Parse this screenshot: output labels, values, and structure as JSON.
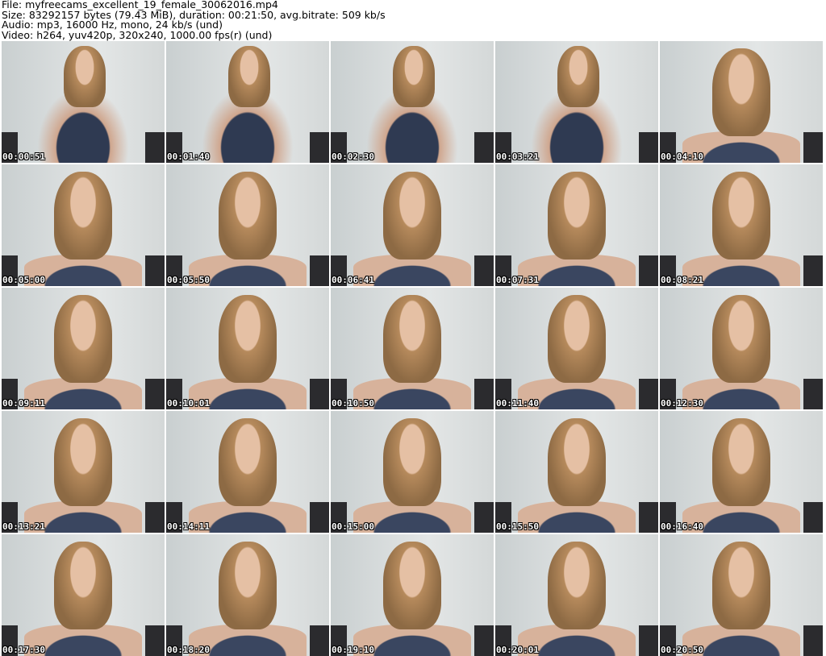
{
  "header": {
    "file": "File: myfreecams_excellent_19_female_30062016.mp4",
    "size": "Size: 83292157 bytes (79.43 MiB), duration: 00:21:50, avg.bitrate: 509 kb/s",
    "audio": "Audio: mp3, 16000 Hz, mono, 24 kb/s (und)",
    "video": "Video: h264, yuv420p, 320x240, 1000.00 fps(r) (und)"
  },
  "thumbnails": [
    "00:00:51",
    "00:01:40",
    "00:02:30",
    "00:03:21",
    "00:04:10",
    "00:05:00",
    "00:05:50",
    "00:06:41",
    "00:07:31",
    "00:08:21",
    "00:09:11",
    "00:10:01",
    "00:10:50",
    "00:11:40",
    "00:12:30",
    "00:13:21",
    "00:14:11",
    "00:15:00",
    "00:15:50",
    "00:16:40",
    "00:17:30",
    "00:18:20",
    "00:19:10",
    "00:20:01",
    "00:20:50"
  ]
}
